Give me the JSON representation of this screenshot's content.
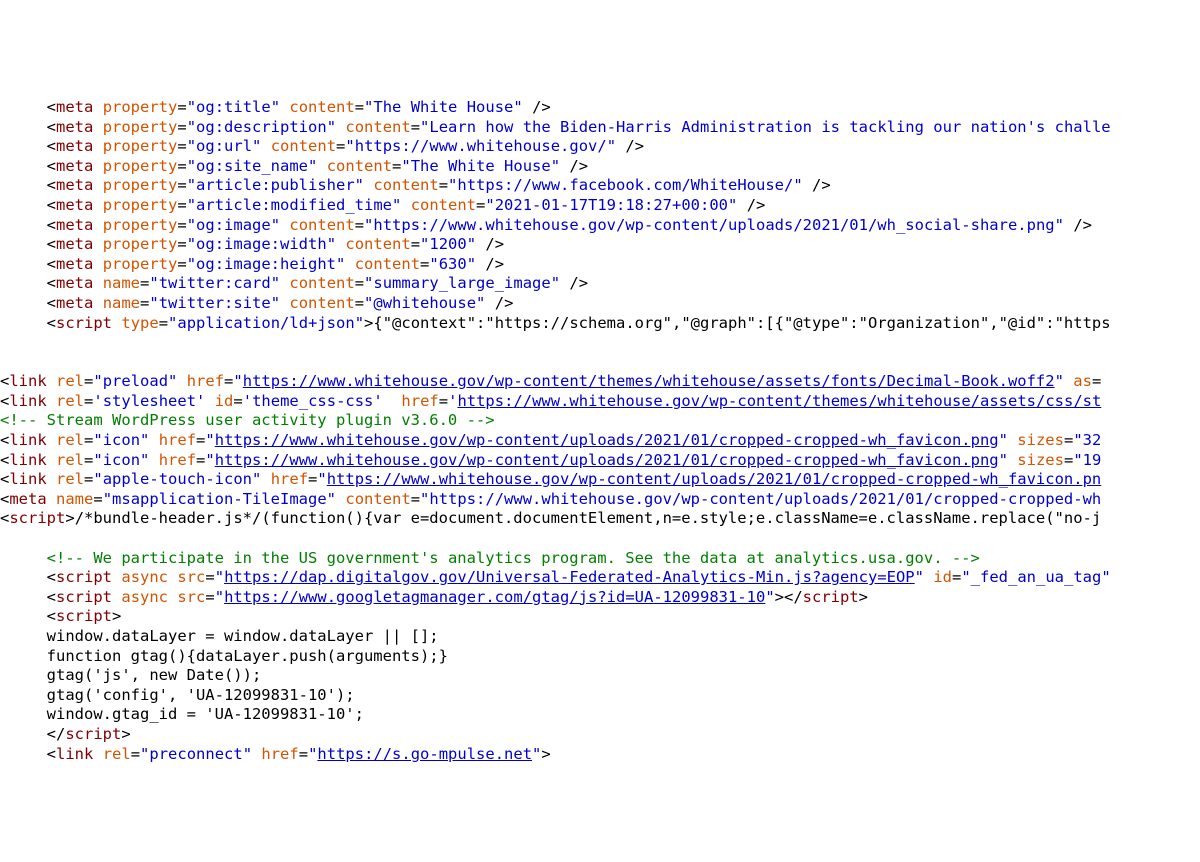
{
  "lines": {
    "l1a": "meta",
    "l1b": "property",
    "l1c": "og:title",
    "l1d": "content",
    "l1e": "The White House",
    "l2c": "og:description",
    "l2e": "Learn how the Biden-Harris Administration is tackling our nation's challe",
    "l3c": "og:url",
    "l3e": "https://www.whitehouse.gov/",
    "l4c": "og:site_name",
    "l4e": "The White House",
    "l5c": "article:publisher",
    "l5e": "https://www.facebook.com/WhiteHouse/",
    "l6c": "article:modified_time",
    "l6e": "2021-01-17T19:18:27+00:00",
    "l7c": "og:image",
    "l7e": "https://www.whitehouse.gov/wp-content/uploads/2021/01/wh_social-share.png",
    "l8c": "og:image:width",
    "l8e": "1200",
    "l9c": "og:image:height",
    "l9e": "630",
    "l10b": "name",
    "l10c": "twitter:card",
    "l10e": "summary_large_image",
    "l11c": "twitter:site",
    "l11e": "@whitehouse",
    "l12a": "script",
    "l12b": "type",
    "l12c": "application/ld+json",
    "l12d": "{\"@context\":\"https://schema.org\",\"@graph\":[{\"@type\":\"Organization\",\"@id\":\"https",
    "p1a": "link",
    "p1b": "rel",
    "p1c": "preload",
    "p1d": "href",
    "p1e": "https://www.whitehouse.gov/wp-content/themes/whitehouse/assets/fonts/Decimal-Book.woff2",
    "p1f": "as",
    "p2c": "stylesheet",
    "p2g": "id",
    "p2h": "theme_css-css",
    "p2e": "https://www.whitehouse.gov/wp-content/themes/whitehouse/assets/css/st",
    "p3": "<!-- Stream WordPress user activity plugin v3.6.0 -->",
    "p4c": "icon",
    "p4e": "https://www.whitehouse.gov/wp-content/uploads/2021/01/cropped-cropped-wh_favicon.png",
    "p4s": "sizes",
    "p4sv": "32",
    "p5sv": "19",
    "p6c": "apple-touch-icon",
    "p6e": "https://www.whitehouse.gov/wp-content/uploads/2021/01/cropped-cropped-wh_favicon.pn",
    "p7a": "meta",
    "p7b": "name",
    "p7c": "msapplication-TileImage",
    "p7d": "content",
    "p7e": "https://www.whitehouse.gov/wp-content/uploads/2021/01/cropped-cropped-wh",
    "p8a": "script",
    "p8b": "/*bundle-header.js*/(function(){var e=document.documentElement,n=e.style;e.className=e.className.replace(\"no-j",
    "c1": "<!-- We participate in the US government's analytics program. See the data at analytics.usa.gov. -->",
    "s1a": "script",
    "s1b": "async",
    "s1c": "src",
    "s1d": "https://dap.digitalgov.gov/Universal-Federated-Analytics-Min.js?agency=EOP",
    "s1e": "id",
    "s1f": "_fed_an_ua_tag",
    "s2d": "https://www.googletagmanager.com/gtag/js?id=UA-12099831-10",
    "s3_open": "<script>",
    "s3l1": "window.dataLayer = window.dataLayer || [];",
    "s3l2": "function gtag(){dataLayer.push(arguments);}",
    "s3l3": "gtag('js', new Date());",
    "s3l4": "gtag('config', 'UA-12099831-10');",
    "s3l5": "window.gtag_id = 'UA-12099831-10';",
    "s3_close": "script",
    "pc1c": "preconnect",
    "pc1e": "https://s.go-mpulse.net"
  }
}
